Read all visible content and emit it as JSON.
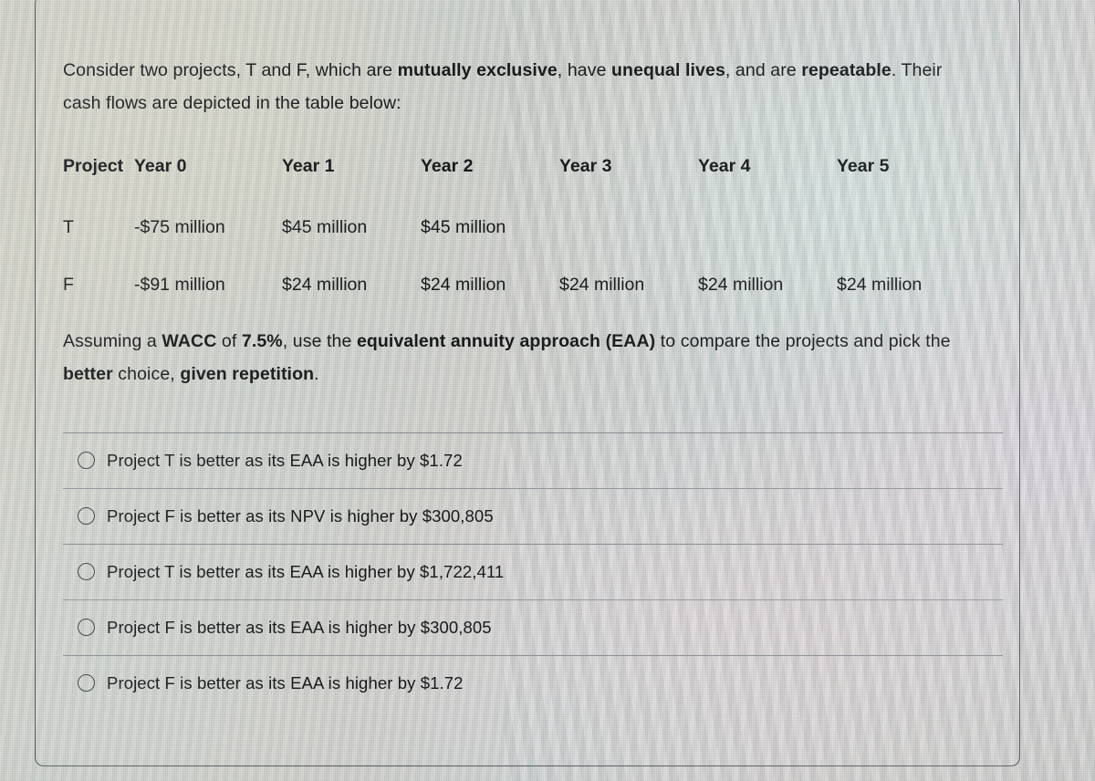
{
  "prompt": {
    "line1_a": "Consider two projects, T and F, which are ",
    "line1_b": "mutually exclusive",
    "line1_c": ", have ",
    "line1_d": "unequal lives",
    "line1_e": ", and are ",
    "line1_f": "repeatable",
    "line1_g": ". Their cash flows are depicted in the table below:",
    "line2_a": "Assuming a ",
    "line2_b": "WACC",
    "line2_c": " of ",
    "line2_d": "7.5%",
    "line2_e": ", use the ",
    "line2_f": "equivalent annuity approach (EAA)",
    "line2_g": " to compare the projects and pick the ",
    "line2_h": "better",
    "line2_i": " choice, ",
    "line2_j": "given repetition",
    "line2_k": "."
  },
  "table": {
    "headers": [
      "Project",
      "Year 0",
      "Year 1",
      "Year 2",
      "Year 3",
      "Year 4",
      "Year 5"
    ],
    "rows": [
      {
        "project": "T",
        "year0": "-$75 million",
        "year1": "$45 million",
        "year2": "$45 million",
        "year3": "",
        "year4": "",
        "year5": ""
      },
      {
        "project": "F",
        "year0": "-$91 million",
        "year1": "$24 million",
        "year2": "$24 million",
        "year3": "$24 million",
        "year4": "$24 million",
        "year5": "$24 million"
      }
    ]
  },
  "options": [
    {
      "label": "Project T is better as its EAA is higher by $1.72",
      "selected": false
    },
    {
      "label": "Project F is better as its NPV is higher by $300,805",
      "selected": false
    },
    {
      "label": "Project T is better as its EAA is higher by $1,722,411",
      "selected": false
    },
    {
      "label": "Project F is better as its EAA is higher by $300,805",
      "selected": false
    },
    {
      "label": "Project F is better as its EAA is higher by $1.72",
      "selected": false
    }
  ],
  "colors": {
    "text": "#16181a",
    "card_border": "#4e545a",
    "option_divider": "#8b9096",
    "radio_outline": "#3a3f44"
  }
}
